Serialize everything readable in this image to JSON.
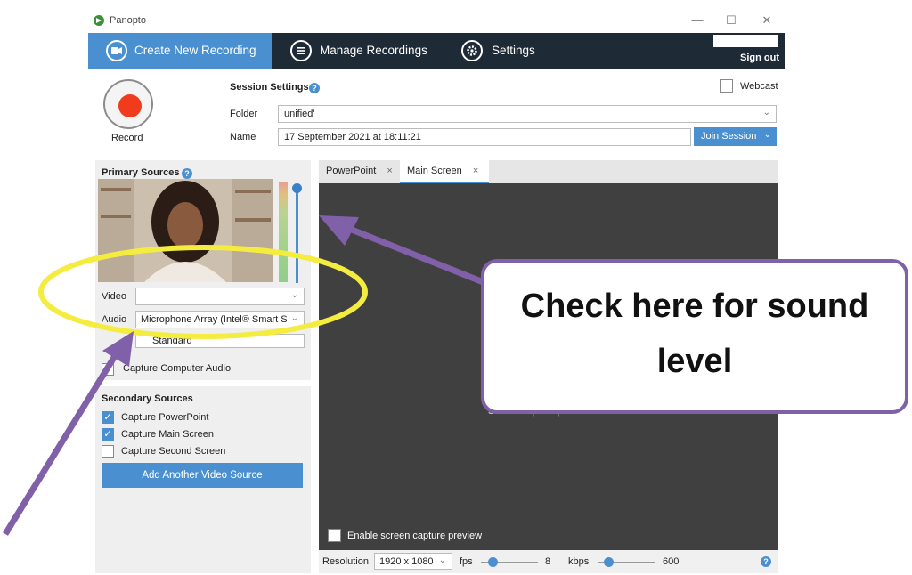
{
  "window": {
    "title": "Panopto",
    "controls": [
      "—",
      "☐",
      "✕"
    ]
  },
  "nav": {
    "tabs": [
      {
        "label": "Create New Recording",
        "icon": "camera-icon"
      },
      {
        "label": "Manage Recordings",
        "icon": "list-icon"
      },
      {
        "label": "Settings",
        "icon": "gear-icon"
      }
    ],
    "sign_out": "Sign out"
  },
  "record": {
    "label": "Record",
    "color": "#f03c1c"
  },
  "session": {
    "title": "Session Settings",
    "help": "?",
    "webcast_label": "Webcast",
    "folder_label": "Folder",
    "folder_value": "unified'",
    "name_label": "Name",
    "name_value": "17 September 2021 at 18:11:21",
    "join_button": "Join Session"
  },
  "primary": {
    "title": "Primary Sources",
    "video_label": "Video",
    "audio_label": "Audio",
    "audio_value": "Microphone Array (Intel® Smart S",
    "quality_value": "Standard",
    "capture_audio_label": "Capture Computer Audio"
  },
  "secondary": {
    "title": "Secondary Sources",
    "items": [
      {
        "label": "Capture PowerPoint",
        "checked": true
      },
      {
        "label": "Capture Main Screen",
        "checked": true
      },
      {
        "label": "Capture Second Screen",
        "checked": false
      }
    ],
    "add_button": "Add Another Video Source"
  },
  "preview": {
    "tabs": [
      {
        "label": "PowerPoint",
        "close": "×"
      },
      {
        "label": "Main Screen",
        "close": "×"
      }
    ],
    "hidden_message": "Screen capture preview is hidden",
    "enable_label": "Enable screen capture preview"
  },
  "bottom": {
    "resolution_label": "Resolution",
    "resolution_value": "1920 x 1080",
    "fps_label": "fps",
    "fps_value": "8",
    "kbps_label": "kbps",
    "kbps_value": "600"
  },
  "callout": {
    "line1": "Check here for sound",
    "line2": "level"
  },
  "colors": {
    "accent": "#4a90d0",
    "nav_bg": "#1f2a37",
    "annotation": "#8060a8",
    "highlight": "#f5ec40"
  }
}
